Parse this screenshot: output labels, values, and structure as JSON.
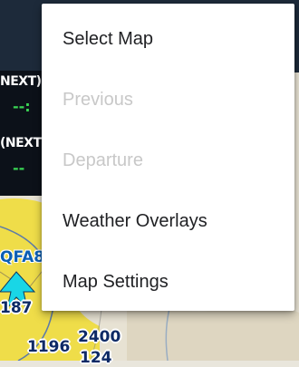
{
  "menu": {
    "items": [
      {
        "label": "Select Map",
        "enabled": true
      },
      {
        "label": "Previous",
        "enabled": false
      },
      {
        "label": "Departure",
        "enabled": false
      },
      {
        "label": "Weather Overlays",
        "enabled": true
      },
      {
        "label": "Map Settings",
        "enabled": true
      }
    ]
  },
  "map": {
    "hud_top_label": "NEXT)",
    "hud_top_value": "--:",
    "hud_bottom_label": "(NEXT",
    "hud_bottom_value": "--",
    "airport_label": "QFA8",
    "numbers": [
      "187",
      "1196",
      "2400",
      "124"
    ]
  },
  "colors": {
    "menu_text": "#202124",
    "menu_disabled": "#c8c8c8",
    "hud_background": "#0c1119",
    "hud_value": "#39d353",
    "airspace_yellow": "#f0dd3a",
    "aircraft_cyan": "#19d6e6"
  }
}
